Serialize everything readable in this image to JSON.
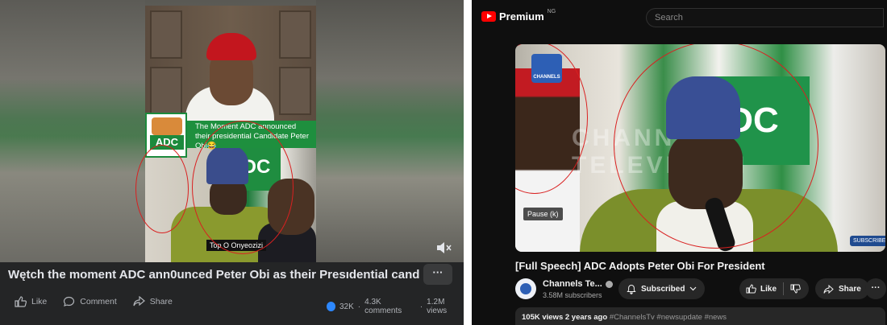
{
  "facebook": {
    "video": {
      "caption": "The Moment ADC announced their presidential Candidate Peter Obi😂",
      "logo_text": "ADC",
      "name_tag": "Top O Onyeozizi",
      "inner_banner": "DC"
    },
    "title": "Wętch the moment ADC ann0unced Peter Obi as their Presıdential cand...",
    "more_label": "···",
    "actions": [
      {
        "label": "Like",
        "icon": "thumbs-up-icon"
      },
      {
        "label": "Comment",
        "icon": "comment-icon"
      },
      {
        "label": "Share",
        "icon": "share-icon"
      }
    ],
    "stats": {
      "reactions": "32K",
      "comments": "4.3K comments",
      "views": "1.2M views",
      "separator": "·"
    }
  },
  "youtube": {
    "brand": "Premium",
    "region": "NG",
    "search_placeholder": "Search",
    "video": {
      "channel_logo_text": "CHANNELS",
      "pause_tooltip": "Pause (k)",
      "watermark": "CHANNELS TELEVISION",
      "adc_banner": "DC",
      "subscribe_corner": "SUBSCRIBE"
    },
    "title": "[Full Speech] ADC Adopts Peter Obi For President",
    "channel": {
      "name": "Channels Te...",
      "subscribers": "3.58M subscribers"
    },
    "subscribe_label": "Subscribed",
    "like_label": "Like",
    "share_label": "Share",
    "more_label": "···",
    "description": {
      "views": "105K views",
      "age": "2 years ago",
      "tags": "#ChannelsTv #newsupdate #news"
    }
  },
  "colors": {
    "annotation_ring": "#d92020",
    "facebook_bg": "#242526",
    "youtube_bg": "#0f0f0f",
    "youtube_red": "#ff0000",
    "adc_green": "#1e8f3e"
  }
}
